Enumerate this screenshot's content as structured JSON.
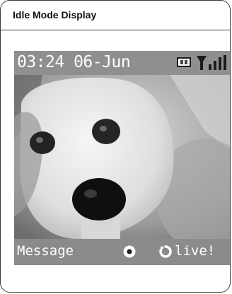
{
  "header": {
    "title": "Idle Mode Display"
  },
  "status_bar": {
    "datetime": "03:24 06-Jun",
    "battery_icon": "battery-icon",
    "signal_icon": "signal-strength-icon"
  },
  "wallpaper": {
    "subject": "dog-wallpaper-image"
  },
  "softkeys": {
    "left_label": "Message",
    "center_icon": "ok-circle-icon",
    "right_icon": "live-logo-icon",
    "right_label": "live!"
  },
  "colors": {
    "status_bar_bg": "#8f8f8f",
    "softkey_bar_bg": "#8b8b8b",
    "text": "#ffffff",
    "frame_border": "#3a3a3a"
  }
}
